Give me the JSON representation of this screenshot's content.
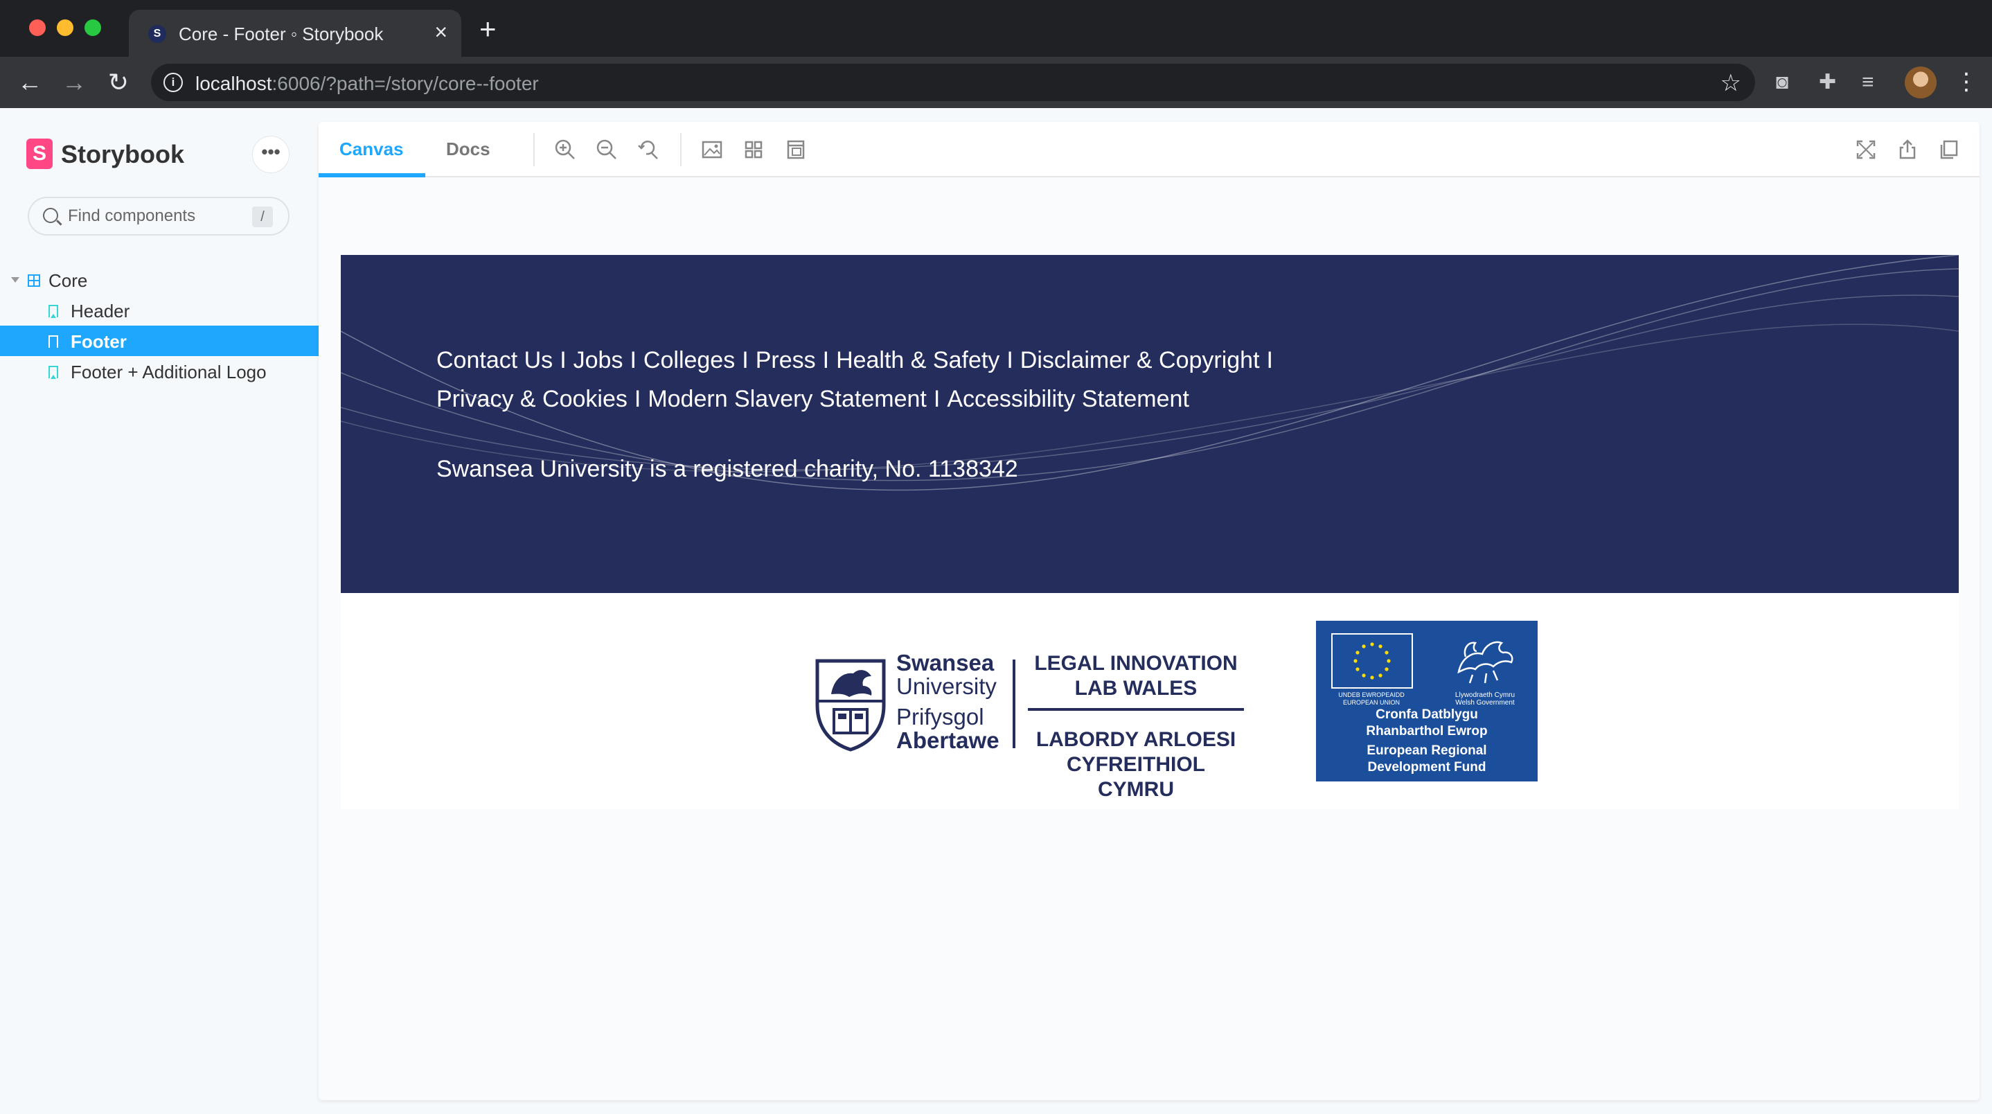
{
  "browser": {
    "tab_title": "Core - Footer ◦ Storybook",
    "url_host": "localhost",
    "url_rest": ":6006/?path=/story/core--footer"
  },
  "sidebar": {
    "brand": "Storybook",
    "search_placeholder": "Find components",
    "search_shortcut": "/",
    "tree": {
      "group": "Core",
      "stories": [
        "Header",
        "Footer",
        "Footer + Additional Logo"
      ],
      "selected": "Footer"
    }
  },
  "panel": {
    "tabs": [
      "Canvas",
      "Docs"
    ],
    "active_tab": "Canvas"
  },
  "footer": {
    "line1": [
      "Contact Us",
      "Jobs",
      "Colleges",
      "Press",
      "Health & Safety",
      "Disclaimer & Copyright"
    ],
    "line2": [
      "Privacy & Cookies",
      "Modern Slavery Statement",
      "Accessibility Statement"
    ],
    "separator": "I",
    "charity": "Swansea University is a registered charity, No. 1138342",
    "background_color": "#242d5b"
  },
  "logos": {
    "swansea": {
      "en_line1": "Swansea",
      "en_line2": "University",
      "cy_line1": "Prifysgol",
      "cy_line2": "Abertawe"
    },
    "lab": {
      "en_line1": "LEGAL INNOVATION",
      "en_line2": "LAB WALES",
      "cy_line1": "LABORDY ARLOESI",
      "cy_line2": "CYFREITHIOL CYMRU"
    },
    "erdf": {
      "eu_caption_line1": "UNDEB EWROPEAIDD",
      "eu_caption_line2": "EUROPEAN UNION",
      "welsh_caption_line1": "Llywodraeth Cymru",
      "welsh_caption_line2": "Welsh Government",
      "cy_line1": "Cronfa Datblygu",
      "cy_line2": "Rhanbarthol Ewrop",
      "en_line1": "European Regional",
      "en_line2": "Development Fund",
      "background_color": "#1b4f9c"
    }
  },
  "colors": {
    "storybook_accent": "#1ea7fd",
    "storybook_logo": "#ff4785",
    "navy": "#242d5b"
  }
}
